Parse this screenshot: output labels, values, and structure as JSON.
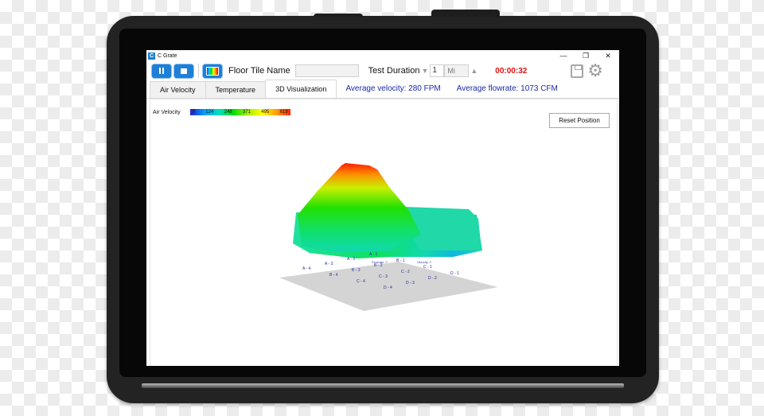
{
  "window": {
    "title": "C Grate",
    "app_icon_letter": "C",
    "minimize_glyph": "—",
    "restore_glyph": "❐",
    "close_glyph": "✕"
  },
  "toolbar": {
    "floor_tile_label": "Floor Tile Name",
    "floor_tile_value": "",
    "test_duration_label": "Test Duration",
    "duration_value": "1",
    "duration_unit": "Mi",
    "timer": "00:00:32"
  },
  "tabs": [
    {
      "label": "Air Velocity",
      "active": false
    },
    {
      "label": "Temperature",
      "active": false
    },
    {
      "label": "3D Visualization",
      "active": true
    }
  ],
  "stats": {
    "average_velocity": "Average velocity: 280 FPM",
    "average_flowrate": "Average flowrate: 1073 CFM"
  },
  "visualization": {
    "legend_title": "Air Velocity",
    "colorbar_ticks": [
      "0",
      "124",
      "248",
      "371",
      "495",
      "619"
    ],
    "reset_button": "Reset Position",
    "grid_labels": [
      {
        "id": "A-1",
        "text": "A - 1"
      },
      {
        "id": "A-2",
        "text": "A - 2"
      },
      {
        "id": "A-3",
        "text": "A - 3"
      },
      {
        "id": "A-4",
        "text": "A - 4"
      },
      {
        "id": "B-1",
        "text": "B - 1"
      },
      {
        "id": "B-2",
        "text": "B - 2"
      },
      {
        "id": "B-3",
        "text": "B - 3"
      },
      {
        "id": "B-4",
        "text": "B - 4"
      },
      {
        "id": "C-1",
        "text": "C - 1"
      },
      {
        "id": "C-2",
        "text": "C - 2"
      },
      {
        "id": "C-3",
        "text": "C - 3"
      },
      {
        "id": "C-4",
        "text": "C - 4"
      },
      {
        "id": "D-1",
        "text": "D - 1"
      },
      {
        "id": "D-2",
        "text": "D - 2"
      },
      {
        "id": "D-3",
        "text": "D - 3"
      },
      {
        "id": "D-4",
        "text": "D - 4"
      }
    ]
  },
  "colors": {
    "accent": "#1e7fd6",
    "timer": "#e01010",
    "stat_text": "#1a2aa8"
  }
}
